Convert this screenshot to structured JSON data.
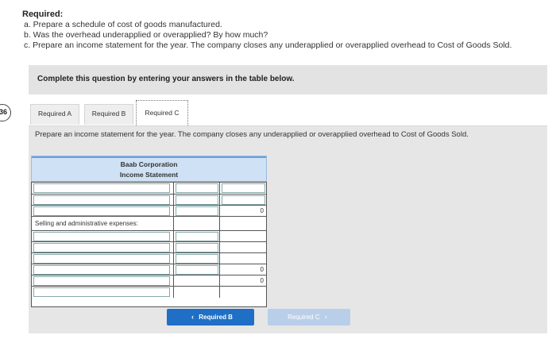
{
  "step_badge": "36",
  "required": {
    "title": "Required:",
    "items": [
      "a. Prepare a schedule of cost of goods manufactured.",
      "b. Was the overhead underapplied or overapplied? By how much?",
      "c. Prepare an income statement for the year. The company closes any underapplied or overapplied overhead to Cost of Goods Sold."
    ]
  },
  "instruction": "Complete this question by entering your answers in the table below.",
  "tabs": [
    {
      "label": "Required A"
    },
    {
      "label": "Required B"
    },
    {
      "label": "Required C",
      "active": true
    }
  ],
  "prompt": "Prepare an income statement for the year. The company closes any underapplied or overapplied overhead to Cost of Goods Sold.",
  "statement": {
    "company": "Baab Corporation",
    "title": "Income Statement",
    "rows": [
      {
        "label": "",
        "mid": "",
        "right": ""
      },
      {
        "label": "",
        "mid": "",
        "right": ""
      },
      {
        "label": "",
        "mid": "",
        "right": "0"
      },
      {
        "label": "Selling and administrative expenses:",
        "mid": "",
        "right": ""
      },
      {
        "label": "",
        "mid": "",
        "right": ""
      },
      {
        "label": "",
        "mid": "",
        "right": ""
      },
      {
        "label": "",
        "mid": "",
        "right": ""
      },
      {
        "label": "",
        "mid": "",
        "right": "0"
      },
      {
        "label": "",
        "mid": "",
        "right": "0"
      }
    ]
  },
  "nav": {
    "prev_label": "Required B",
    "next_label": "Required C",
    "prev_arrow": "‹",
    "next_arrow": "›"
  },
  "colors": {
    "primary_button": "#1f6fc6",
    "disabled_button": "#b9cfe9",
    "table_header": "#cfe1f4"
  }
}
